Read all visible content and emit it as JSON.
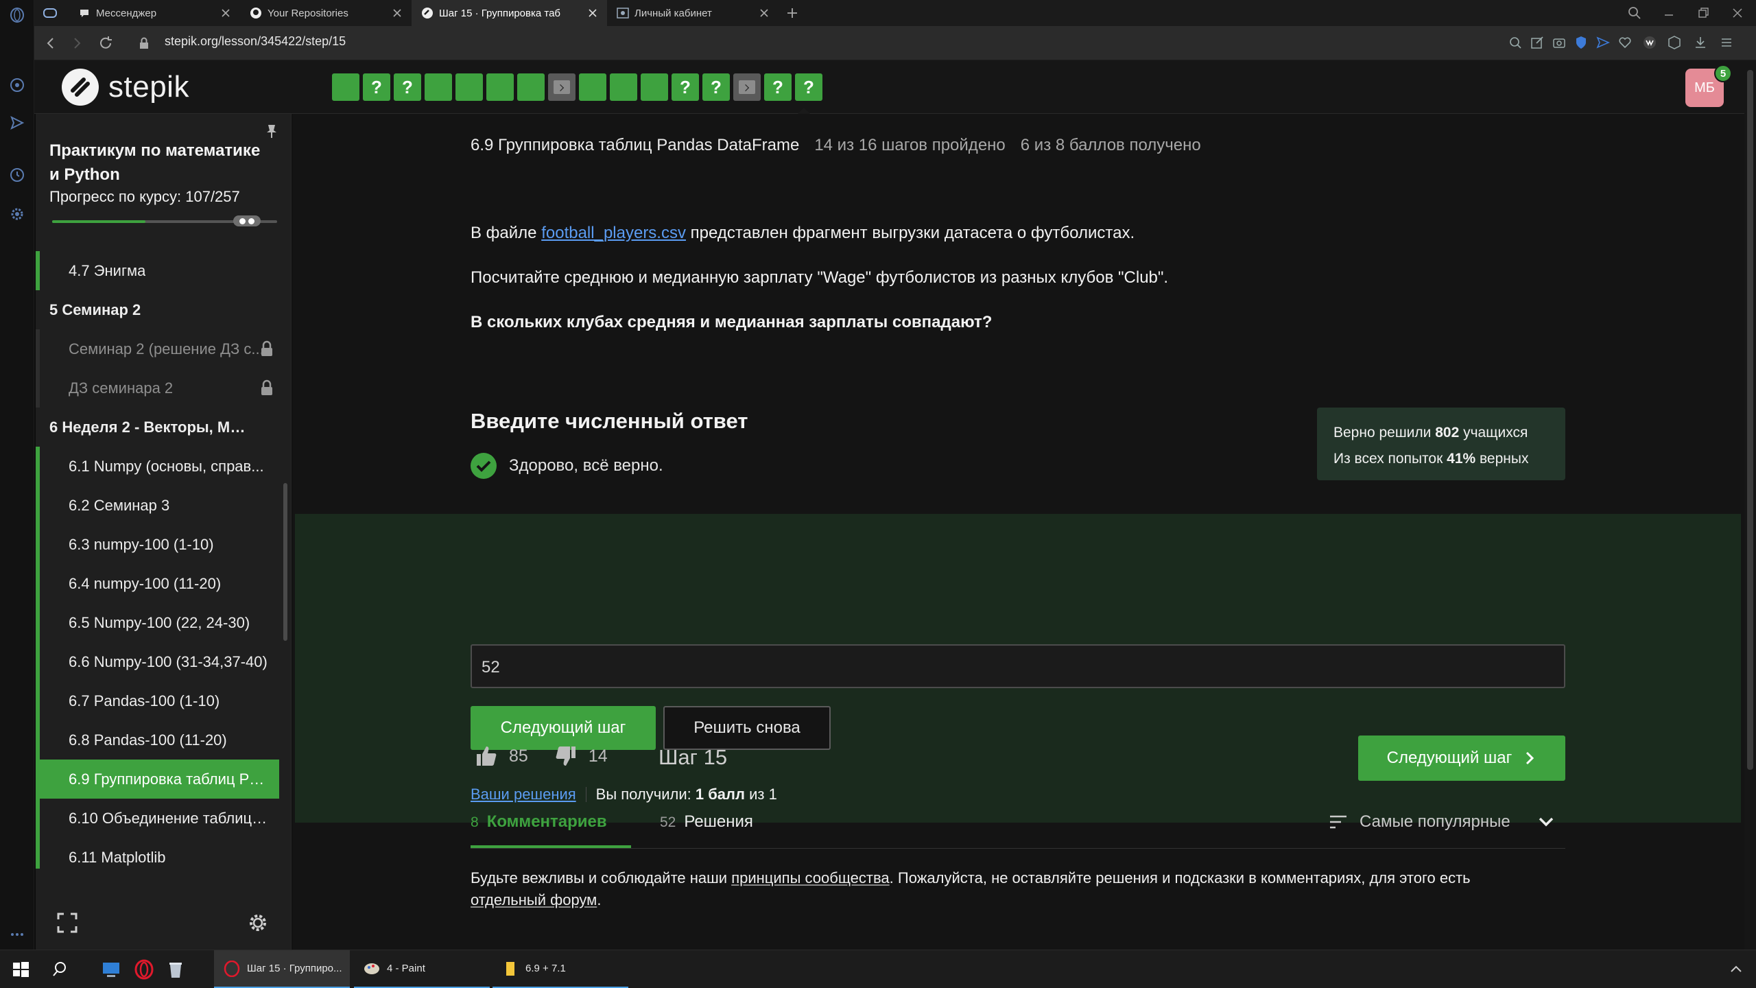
{
  "browser": {
    "tabs": [
      {
        "title": "Мессенджер",
        "active": false
      },
      {
        "title": "Your Repositories",
        "active": false
      },
      {
        "title": "Шаг 15 · Группировка таб",
        "active": true
      },
      {
        "title": "Личный кабинет",
        "active": false
      }
    ],
    "url": "stepik.org/lesson/345422/step/15"
  },
  "header": {
    "logo_text": "stepik",
    "steps": [
      {
        "kind": "ok",
        "label": ""
      },
      {
        "kind": "ok",
        "label": "?"
      },
      {
        "kind": "ok",
        "label": "?"
      },
      {
        "kind": "ok",
        "label": ""
      },
      {
        "kind": "ok",
        "label": ""
      },
      {
        "kind": "ok",
        "label": ""
      },
      {
        "kind": "ok",
        "label": ""
      },
      {
        "kind": "code",
        "label": ""
      },
      {
        "kind": "ok",
        "label": ""
      },
      {
        "kind": "ok",
        "label": ""
      },
      {
        "kind": "ok",
        "label": ""
      },
      {
        "kind": "ok",
        "label": "?"
      },
      {
        "kind": "ok",
        "label": "?"
      },
      {
        "kind": "code",
        "label": ""
      },
      {
        "kind": "ok",
        "label": "?"
      },
      {
        "kind": "ok",
        "label": "?"
      }
    ],
    "avatar_initials": "МБ",
    "notifications": "5"
  },
  "sidebar": {
    "course_title": "Практикум по математике и Python",
    "progress_label": "Прогресс по курсу:  107/257",
    "progress_fraction": 0.416,
    "items": [
      {
        "label": "4.7  Энигма",
        "type": "lesson"
      },
      {
        "label": "5  Семинар 2",
        "type": "section"
      },
      {
        "label": "Семинар 2 (решение ДЗ с...",
        "type": "locked"
      },
      {
        "label": "ДЗ семинара 2",
        "type": "locked"
      },
      {
        "label": "6  Неделя 2 - Векторы, Ма...",
        "type": "section"
      },
      {
        "label": "6.1  Numpy (основы, справ...",
        "type": "lesson"
      },
      {
        "label": "6.2  Семинар 3",
        "type": "lesson"
      },
      {
        "label": "6.3  numpy-100 (1-10)",
        "type": "lesson"
      },
      {
        "label": "6.4  numpy-100 (11-20)",
        "type": "lesson"
      },
      {
        "label": "6.5  Numpy-100 (22, 24-30)",
        "type": "lesson"
      },
      {
        "label": "6.6  Numpy-100 (31-34,37-40)",
        "type": "lesson"
      },
      {
        "label": "6.7  Pandas-100 (1-10)",
        "type": "lesson"
      },
      {
        "label": "6.8  Pandas-100 (11-20)",
        "type": "lesson"
      },
      {
        "label": "6.9  Группировка таблиц Pa...",
        "type": "active"
      },
      {
        "label": "6.10  Объединение таблиц ...",
        "type": "lesson"
      },
      {
        "label": "6.11  Matplotlib",
        "type": "lesson"
      }
    ]
  },
  "lesson": {
    "title": "6.9 Группировка таблиц Pandas DataFrame",
    "steps_passed": "14 из 16 шагов пройдено",
    "points": "6 из 8 баллов  получено",
    "para1_prefix": "В файле ",
    "para1_link": "football_players.csv",
    "para1_suffix": " представлен фрагмент выгрузки датасета о футболистах.",
    "para2": "Посчитайте среднюю и медианную зарплату \"Wage\" футболистов из разных клубов \"Club\".",
    "para3": "В скольких клубах средняя и медианная зарплаты совпадают?",
    "answer_title": "Введите численный ответ",
    "correct_text": "Здорово, всё верно.",
    "stats_line1_prefix": "Верно решили ",
    "stats_line1_value": "802",
    "stats_line1_suffix": " учащихся",
    "stats_line2_prefix": "Из всех попыток ",
    "stats_line2_value": "41%",
    "stats_line2_suffix": " верных",
    "answer_value": "52",
    "next_button": "Следующий шаг",
    "retry_button": "Решить снова",
    "your_solutions": "Ваши решения",
    "score_prefix": "Вы получили: ",
    "score_value": "1 балл",
    "score_suffix": " из 1",
    "likes": "85",
    "dislikes": "14",
    "step_label": "Шаг 15",
    "next_button2": "Следующий шаг"
  },
  "discussion": {
    "comments_count": "8",
    "comments_label": "Комментариев",
    "solutions_count": "52",
    "solutions_label": "Решения",
    "sort_label": "Самые популярные",
    "rules_part1": "Будьте вежливы и соблюдайте наши ",
    "rules_link1": "принципы сообщества",
    "rules_part2": ". Пожалуйста, не оставляйте решения и подсказки в комментариях, для этого есть ",
    "rules_link2": "отдельный форум",
    "rules_part3": "."
  },
  "taskbar": {
    "apps": [
      {
        "title": "Шаг 15 · Группиро...",
        "icon": "opera-icon"
      },
      {
        "title": "4 - Paint",
        "icon": "paint-icon"
      },
      {
        "title": "6.9 + 7.1",
        "icon": "folder-icon"
      }
    ]
  },
  "colors": {
    "accent": "#3ea23f",
    "link": "#5b9cf2",
    "background": "#141414"
  },
  "icons": [
    "search-icon",
    "pin-icon",
    "lock-icon",
    "fullscreen-icon",
    "settings-icon",
    "thumbs-up-icon",
    "thumbs-down-icon",
    "chevron-right-icon",
    "sort-icon",
    "chevron-down-icon",
    "check-icon"
  ]
}
